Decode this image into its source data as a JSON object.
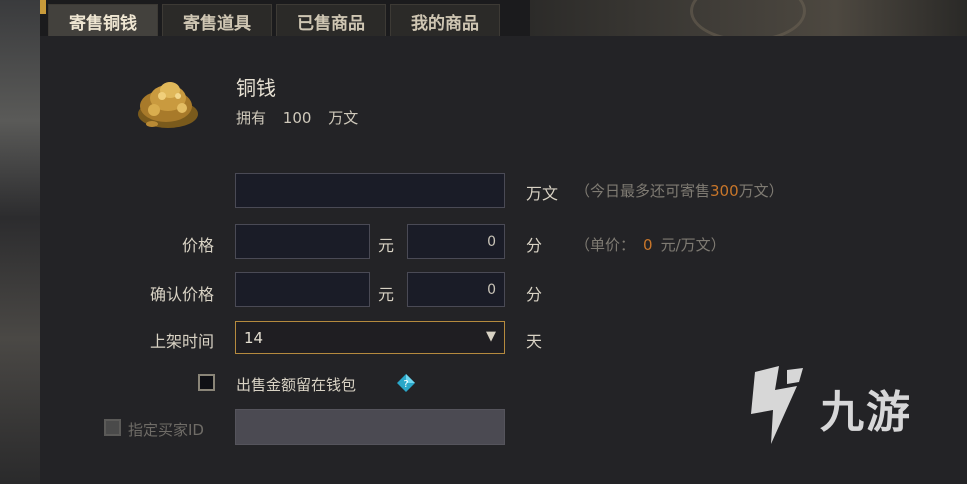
{
  "tabs": [
    {
      "label": "寄售铜钱",
      "active": true
    },
    {
      "label": "寄售道具",
      "active": false
    },
    {
      "label": "已售商品",
      "active": false
    },
    {
      "label": "我的商品",
      "active": false
    }
  ],
  "item": {
    "icon": "coin-pile-icon",
    "name": "铜钱",
    "own_label": "拥有",
    "own_amount": "100",
    "own_unit": "万文"
  },
  "quantity": {
    "value": "",
    "unit": "万文",
    "hint_prefix": "（今日最多还可寄售",
    "hint_amount": "300",
    "hint_suffix": "万文）"
  },
  "price": {
    "label": "价格",
    "yuan_value": "",
    "yuan_unit": "元",
    "fen_value": "0",
    "fen_unit": "分",
    "unit_price_prefix": "（单价：",
    "unit_price_value": "0",
    "unit_price_suffix": "元/万文）"
  },
  "confirm_price": {
    "label": "确认价格",
    "yuan_value": "",
    "yuan_unit": "元",
    "fen_value": "0",
    "fen_unit": "分"
  },
  "duration": {
    "label": "上架时间",
    "selected": "14",
    "unit": "天"
  },
  "keep_in_wallet": {
    "label": "出售金额留在钱包",
    "checked": false,
    "help_icon": "diamond-help-icon"
  },
  "buyer": {
    "label": "指定买家ID",
    "checked": false,
    "enabled": false,
    "value": ""
  },
  "watermark": {
    "text": "九游",
    "icon": "nine-game-logo-icon"
  },
  "colors": {
    "accent_gold": "#c89a3a",
    "highlight_orange": "#c8762a"
  }
}
